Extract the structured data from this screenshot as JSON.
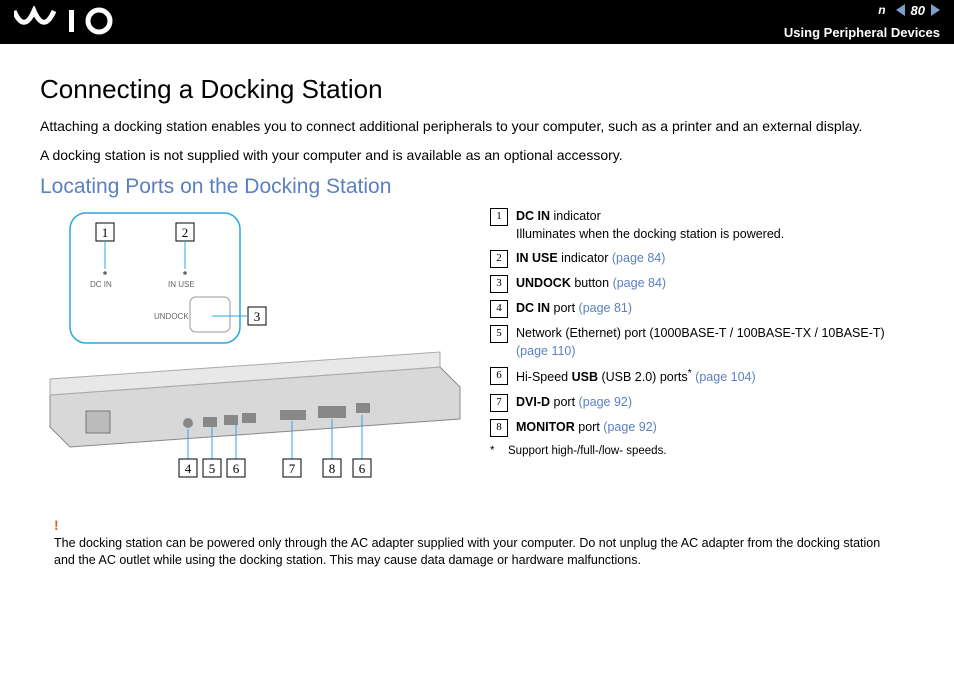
{
  "header": {
    "page_number": "80",
    "section": "Using Peripheral Devices",
    "n_mark": "n"
  },
  "title": "Connecting a Docking Station",
  "intro_p1": "Attaching a docking station enables you to connect additional peripherals to your computer, such as a printer and an external display.",
  "intro_p2": "A docking station is not supplied with your computer and is available as an optional accessory.",
  "subhead": "Locating Ports on the Docking Station",
  "diagram": {
    "label_dc_in": "DC IN",
    "label_in_use": "IN USE",
    "label_undock": "UNDOCK",
    "callouts_top": [
      "1",
      "2",
      "3"
    ],
    "callouts_bottom": [
      "4",
      "5",
      "6",
      "7",
      "8",
      "6"
    ]
  },
  "legend": [
    {
      "num": "1",
      "html": "<b>DC IN</b> indicator<br>Illuminates when the docking station is powered."
    },
    {
      "num": "2",
      "html": "<b>IN USE</b> indicator <span class='link'>(page 84)</span>"
    },
    {
      "num": "3",
      "html": "<b>UNDOCK</b> button <span class='link'>(page 84)</span>"
    },
    {
      "num": "4",
      "html": "<b>DC IN</b> port <span class='link'>(page 81)</span>"
    },
    {
      "num": "5",
      "html": "Network (Ethernet) port (1000BASE-T / 100BASE-TX / 10BASE-T) <span class='link'>(page 110)</span>"
    },
    {
      "num": "6",
      "html": "Hi-Speed <b>USB</b> (USB 2.0) ports<sup>*</sup> <span class='link'>(page 104)</span>"
    },
    {
      "num": "7",
      "html": "<b>DVI-D</b> port <span class='link'>(page 92)</span>"
    },
    {
      "num": "8",
      "html": "<b>MONITOR</b> port <span class='link'>(page 92)</span>"
    }
  ],
  "footnote": {
    "mark": "*",
    "text": "Support high-/full-/low- speeds."
  },
  "warning": {
    "mark": "!",
    "text": "The docking station can be powered only through the AC adapter supplied with your computer. Do not unplug the AC adapter from the docking station and the AC outlet while using the docking station. This may cause data damage or hardware malfunctions."
  }
}
